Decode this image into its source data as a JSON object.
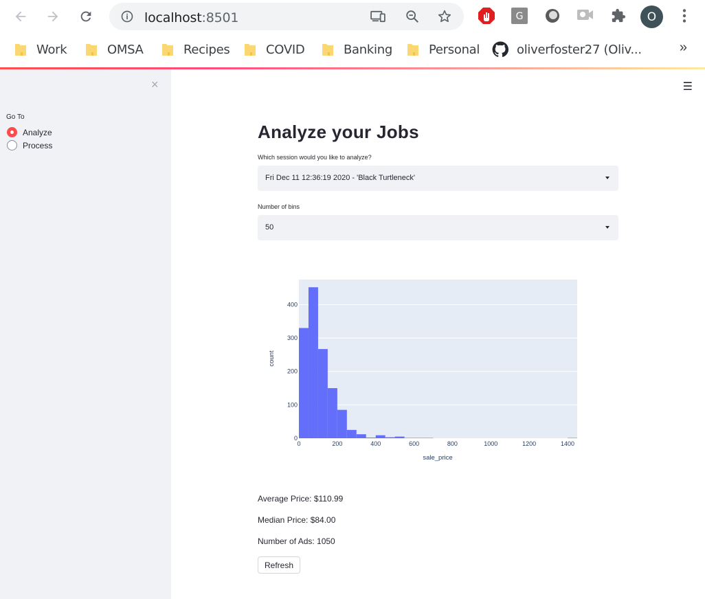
{
  "browser": {
    "url_host": "localhost",
    "url_port": ":8501",
    "profile_initial": "O",
    "bookmarks": [
      "Work",
      "OMSA",
      "Recipes",
      "COVID",
      "Banking",
      "Personal"
    ],
    "github_bookmark": "oliverfoster27 (Oliv...",
    "more_bookmarks": "»"
  },
  "sidebar": {
    "close_glyph": "×",
    "nav_label": "Go To",
    "options": [
      "Analyze",
      "Process"
    ],
    "selected": "Analyze"
  },
  "menu_glyph": "☰",
  "main": {
    "title": "Analyze your Jobs",
    "session_label": "Which session would you like to analyze?",
    "session_value": "Fri Dec 11 12:36:19 2020 - 'Black Turtleneck'",
    "bins_label": "Number of bins",
    "bins_value": "50",
    "avg_price": "Average Price: $110.99",
    "median_price": "Median Price: $84.00",
    "num_ads": "Number of Ads: 1050",
    "refresh_label": "Refresh"
  },
  "chart_data": {
    "type": "bar",
    "title": "",
    "xlabel": "sale_price",
    "ylabel": "count",
    "xlim": [
      0,
      1450
    ],
    "ylim": [
      0,
      475
    ],
    "xticks": [
      0,
      200,
      400,
      600,
      800,
      1000,
      1200,
      1400
    ],
    "yticks": [
      0,
      100,
      200,
      300,
      400
    ],
    "bin_width": 50,
    "bar_color": "#636efa",
    "plot_bg": "#e5ecf6",
    "bins": [
      {
        "x0": 0,
        "x1": 50,
        "value": 330
      },
      {
        "x0": 50,
        "x1": 100,
        "value": 452
      },
      {
        "x0": 100,
        "x1": 150,
        "value": 267
      },
      {
        "x0": 150,
        "x1": 200,
        "value": 150
      },
      {
        "x0": 200,
        "x1": 250,
        "value": 85
      },
      {
        "x0": 250,
        "x1": 300,
        "value": 25
      },
      {
        "x0": 300,
        "x1": 350,
        "value": 12
      },
      {
        "x0": 350,
        "x1": 400,
        "value": 2
      },
      {
        "x0": 400,
        "x1": 450,
        "value": 9
      },
      {
        "x0": 450,
        "x1": 500,
        "value": 3
      },
      {
        "x0": 500,
        "x1": 550,
        "value": 5
      },
      {
        "x0": 550,
        "x1": 600,
        "value": 1
      },
      {
        "x0": 600,
        "x1": 650,
        "value": 1
      },
      {
        "x0": 650,
        "x1": 700,
        "value": 1
      },
      {
        "x0": 1400,
        "x1": 1450,
        "value": 1
      }
    ]
  }
}
